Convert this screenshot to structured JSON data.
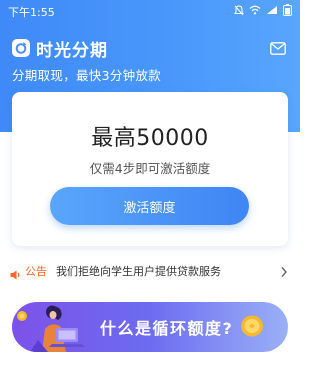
{
  "status_bar": {
    "time": "下午1:55",
    "icons": [
      "bell-off-icon",
      "wifi-icon",
      "signal-icon",
      "battery-icon"
    ]
  },
  "header": {
    "app_name": "时光分期",
    "tagline": "分期取现，最快3分钟放款",
    "icons": [
      "app-logo-icon",
      "mail-icon"
    ]
  },
  "credit_card": {
    "max_amount": "最高50000",
    "steps_note": "仅需4步即可激活额度",
    "activate_label": "激活额度"
  },
  "notice": {
    "label": "公告",
    "text": "我们拒绝向学生用户提供贷款服务",
    "icons": [
      "speaker-icon",
      "chevron-right-icon"
    ]
  },
  "promo_banner": {
    "text": "什么是循环额度?",
    "icons": [
      "person-laptop-illustration",
      "coin-icon"
    ]
  },
  "colors": {
    "primary_blue": "#4a90fa",
    "notice_orange": "#f56a2e",
    "promo_purple": "#7d52e8",
    "coin_gold": "#f5b82e"
  }
}
